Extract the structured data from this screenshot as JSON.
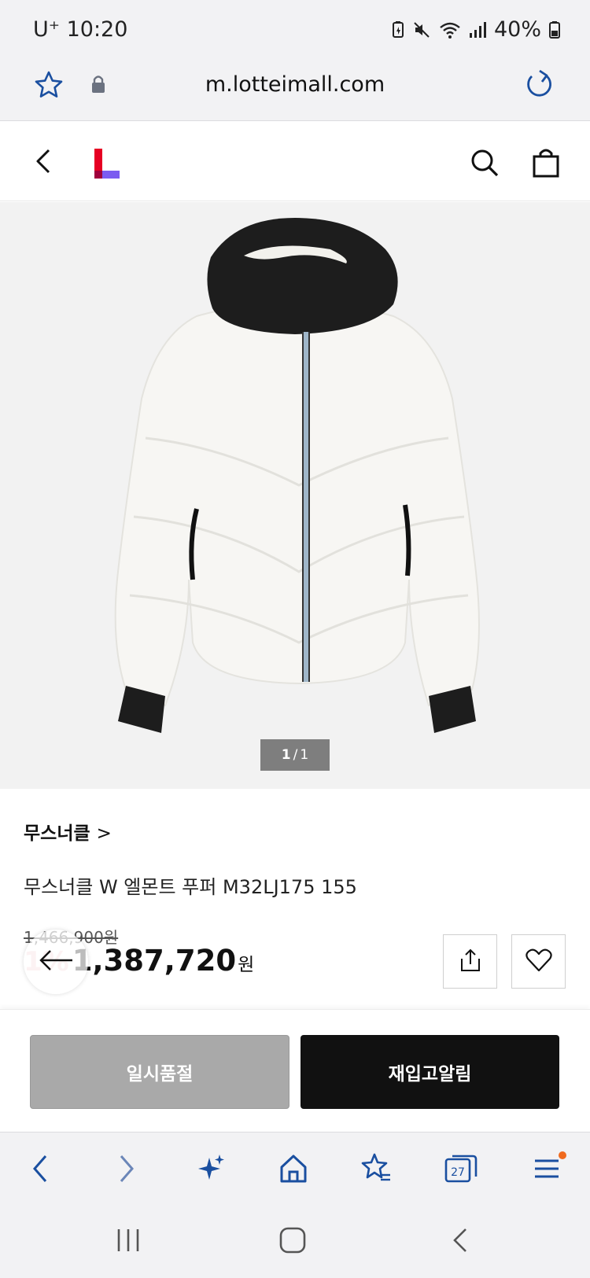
{
  "status_bar": {
    "carrier_time": "U⁺ 10:20",
    "battery": "40%"
  },
  "browser": {
    "url": "m.lotteimall.com",
    "tab_count": "27"
  },
  "gallery": {
    "current": "1",
    "separator": "/",
    "total": "1"
  },
  "product": {
    "brand": "무스너클",
    "brand_chevron": ">",
    "name": "무스너클 W 엘몬트 푸퍼 M32LJ175 155",
    "original_price": "1,466,900원",
    "discount": "1%",
    "sale_price": "1,387,720",
    "currency": "원"
  },
  "actions": {
    "sold_out": "일시품절",
    "restock_alert": "재입고알림"
  },
  "colors": {
    "brand_red": "#e60023",
    "brand_purple": "#7b5cf0",
    "accent_blue": "#1a4fa0"
  }
}
